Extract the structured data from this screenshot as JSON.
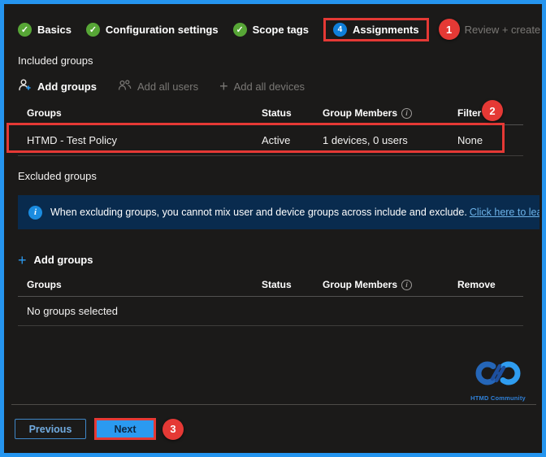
{
  "colors": {
    "frame_accent": "#2595ef",
    "annotation_red": "#e53935",
    "success_green": "#57a636",
    "step_badge_blue": "#0f7fda",
    "banner_bg": "#092b4e",
    "link_blue": "#6cb2e8",
    "background": "#1b1a19"
  },
  "icons": {
    "check": "✓",
    "plus": "+",
    "info": "i"
  },
  "steps": [
    {
      "label": "Basics",
      "state": "done"
    },
    {
      "label": "Configuration settings",
      "state": "done"
    },
    {
      "label": "Scope tags",
      "state": "done"
    },
    {
      "label": "Assignments",
      "state": "current",
      "badge": "4"
    },
    {
      "label": "Review + create",
      "state": "upcoming"
    }
  ],
  "annotations": {
    "one": "1",
    "two": "2",
    "three": "3"
  },
  "included": {
    "heading": "Included groups",
    "toolbar": {
      "add_groups": "Add groups",
      "add_all_users": "Add all users",
      "add_all_devices": "Add all devices"
    },
    "table": {
      "columns": [
        "Groups",
        "Status",
        "Group Members",
        "Filter"
      ],
      "rows": [
        {
          "group": "HTMD - Test Policy",
          "status": "Active",
          "members": "1 devices, 0 users",
          "filter": "None"
        }
      ]
    }
  },
  "excluded": {
    "heading": "Excluded groups",
    "banner": {
      "text": "When excluding groups, you cannot mix user and device groups across include and exclude.",
      "link": "Click here to learn more about"
    },
    "add_groups": "Add groups",
    "table": {
      "columns": [
        "Groups",
        "Status",
        "Group Members",
        "Remove"
      ],
      "empty": "No groups selected"
    }
  },
  "logo": {
    "caption": "HTMD Community"
  },
  "footer": {
    "previous": "Previous",
    "next": "Next"
  }
}
